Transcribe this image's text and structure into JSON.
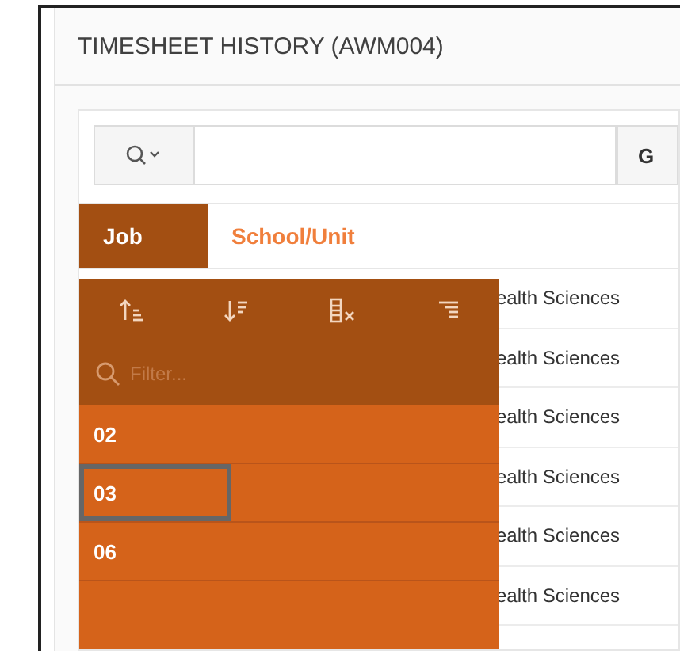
{
  "panel": {
    "title": "TIMESHEET HISTORY (AWM004)"
  },
  "search": {
    "button": "G"
  },
  "columns": [
    {
      "label": "Job",
      "selected": true
    },
    {
      "label": "School/Unit",
      "selected": false
    }
  ],
  "rows": [
    {
      "school": "ealth Sciences"
    },
    {
      "school": "ealth Sciences"
    },
    {
      "school": "ealth Sciences"
    },
    {
      "school": "ealth Sciences"
    },
    {
      "school": "ealth Sciences"
    },
    {
      "school": "ealth Sciences"
    }
  ],
  "column_menu": {
    "filter_placeholder": "Filter...",
    "items": [
      {
        "label": "02",
        "focused": false
      },
      {
        "label": "03",
        "focused": true
      },
      {
        "label": "06",
        "focused": false
      }
    ]
  }
}
